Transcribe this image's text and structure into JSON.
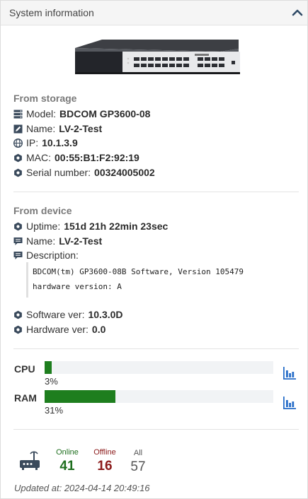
{
  "panel": {
    "title": "System information",
    "collapse_icon": "chevron-up-icon"
  },
  "storage": {
    "title": "From storage",
    "model_label": "Model:",
    "model_value": "BDCOM GP3600-08",
    "name_label": "Name:",
    "name_value": "LV-2-Test",
    "ip_label": "IP:",
    "ip_value": "10.1.3.9",
    "mac_label": "MAC:",
    "mac_value": "00:55:B1:F2:92:19",
    "serial_label": "Serial number:",
    "serial_value": "00324005002"
  },
  "device": {
    "title": "From device",
    "uptime_label": "Uptime:",
    "uptime_value": "151d 21h 22min 23sec",
    "name_label": "Name:",
    "name_value": "LV-2-Test",
    "description_label": "Description:",
    "description_lines": [
      "BDCOM(tm) GP3600-08B Software, Version 105479",
      "hardware version: A"
    ],
    "software_label": "Software ver:",
    "software_value": "10.3.0D",
    "hardware_label": "Hardware ver:",
    "hardware_value": "0.0"
  },
  "resources": {
    "cpu_label": "CPU",
    "cpu_percent": 3,
    "cpu_text": "3%",
    "ram_label": "RAM",
    "ram_percent": 31,
    "ram_text": "31%"
  },
  "onu_stats": {
    "online_label": "Online",
    "online_value": "41",
    "offline_label": "Offline",
    "offline_value": "16",
    "all_label": "All",
    "all_value": "57"
  },
  "footer": {
    "updated": "Updated at: 2024-04-14 20:49:16"
  },
  "colors": {
    "online": "#1e6e1e",
    "offline": "#8b1a1a",
    "bar_fill": "#1e7e1e",
    "icon": "#3a4a5c",
    "chart_icon": "#2a6fc9"
  }
}
